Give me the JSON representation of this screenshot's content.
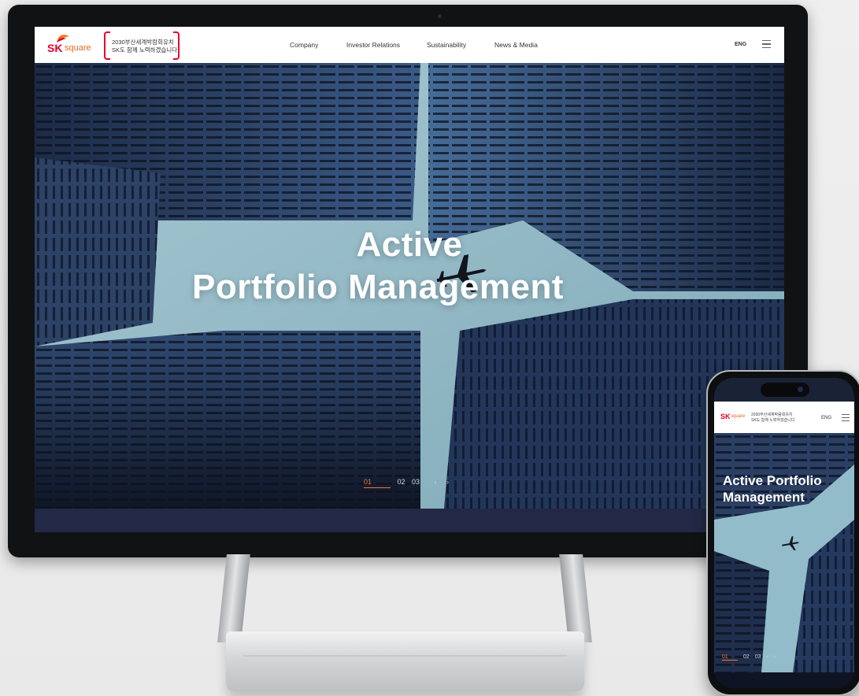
{
  "brand": {
    "logo_sk": "SK",
    "logo_square": "square",
    "campaign_line1": "2030부산세계박람회유치",
    "campaign_line2": "SK도 함께 노력하겠습니다",
    "accent_color": "#e4002b",
    "secondary_color": "#e56a1f"
  },
  "nav": {
    "items": [
      {
        "label": "Company"
      },
      {
        "label": "Investor Relations"
      },
      {
        "label": "Sustainability"
      },
      {
        "label": "News & Media"
      }
    ],
    "lang": "ENG",
    "menu_icon": "hamburger-icon"
  },
  "hero": {
    "title_line1": "Active",
    "title_line2": "Portfolio Management",
    "pager": {
      "current": "01",
      "page2": "02",
      "page3": "03",
      "prev_icon": "chevron-left-icon",
      "next_icon": "chevron-right-icon",
      "prev_glyph": "‹",
      "next_glyph": "›",
      "active_color": "#f2742a"
    },
    "background": "city-skyscrapers-airplane"
  },
  "mobile": {
    "lang": "ENG",
    "title_line1": "Active Portfolio",
    "title_line2": "Management",
    "pager_current": "01",
    "pager_page2": "02",
    "pager_page3": "03"
  }
}
